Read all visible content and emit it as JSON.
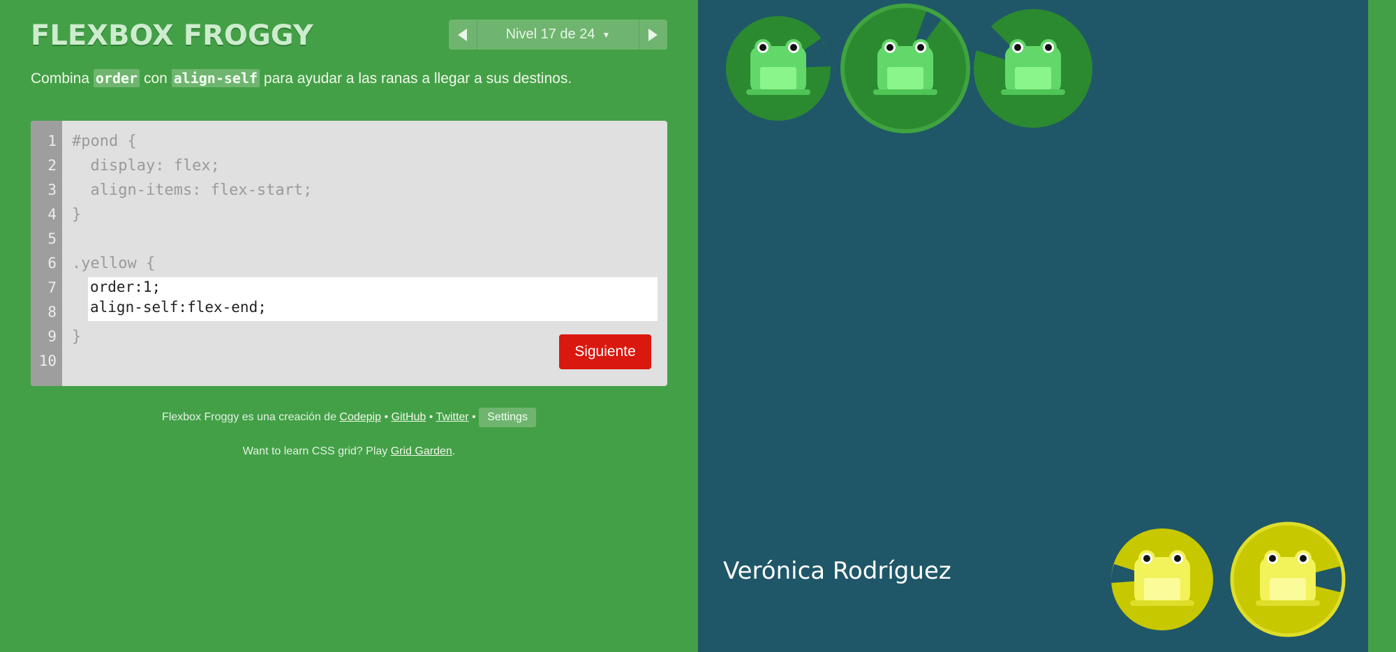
{
  "header": {
    "title": "FLEXBOX FROGGY",
    "level_label": "Nivel 17 de 24"
  },
  "instructions": {
    "prefix": "Combina ",
    "code1": "order",
    "middle": " con ",
    "code2": "align-self",
    "suffix": " para ayudar a las ranas a llegar a sus destinos."
  },
  "editor": {
    "line_numbers": [
      "1",
      "2",
      "3",
      "4",
      "5",
      "6",
      "7",
      "8",
      "9",
      "10"
    ],
    "lines": [
      "#pond {",
      "  display: flex;",
      "  align-items: flex-start;",
      "}",
      "",
      ".yellow {"
    ],
    "closing_line": "}",
    "input_value": "order:1;\nalign-self:flex-end;",
    "next_button": "Siguiente"
  },
  "footer": {
    "credit_prefix": "Flexbox Froggy es una creación de ",
    "link_codepip": "Codepip",
    "sep": " • ",
    "link_github": "GitHub",
    "link_twitter": "Twitter",
    "settings": "Settings",
    "grid_prefix": "Want to learn CSS grid? Play ",
    "link_grid": "Grid Garden",
    "grid_suffix": "."
  },
  "pond": {
    "overlay_name": "Verónica Rodríguez",
    "frogs": [
      "green",
      "green",
      "green",
      "yellow",
      "yellow"
    ]
  },
  "colors": {
    "background": "#43a047",
    "pond": "#1f5768",
    "green_frog": "#62d86a",
    "yellow_frog": "#f2f25a",
    "next_button": "#d9180f"
  }
}
